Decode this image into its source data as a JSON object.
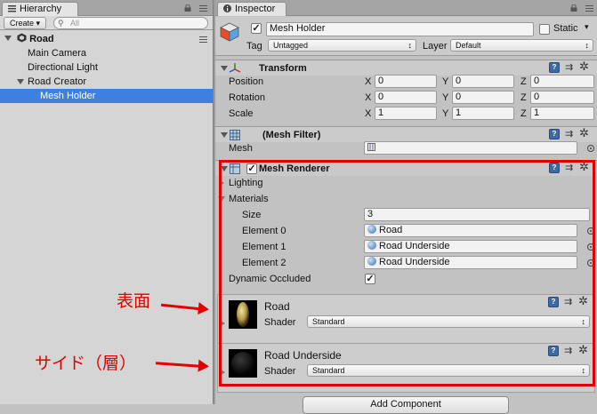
{
  "hierarchy": {
    "tab_label": "Hierarchy",
    "create_label": "Create",
    "search_placeholder": "All",
    "scene_name": "Road",
    "items": [
      {
        "label": "Main Camera"
      },
      {
        "label": "Directional Light"
      },
      {
        "label": "Road Creator"
      },
      {
        "label": "Mesh Holder"
      }
    ]
  },
  "inspector": {
    "tab_label": "Inspector",
    "object_name": "Mesh Holder",
    "static_label": "Static",
    "tag_label": "Tag",
    "tag_value": "Untagged",
    "layer_label": "Layer",
    "layer_value": "Default",
    "transform": {
      "title": "Transform",
      "position_label": "Position",
      "rotation_label": "Rotation",
      "scale_label": "Scale",
      "axis_x": "X",
      "axis_y": "Y",
      "axis_z": "Z",
      "position": [
        "0",
        "0",
        "0"
      ],
      "rotation": [
        "0",
        "0",
        "0"
      ],
      "scale": [
        "1",
        "1",
        "1"
      ]
    },
    "mesh_filter": {
      "title": "(Mesh Filter)",
      "mesh_label": "Mesh"
    },
    "mesh_renderer": {
      "title": "Mesh Renderer",
      "lighting_label": "Lighting",
      "materials_label": "Materials",
      "size_label": "Size",
      "size_value": "3",
      "elements": [
        {
          "label": "Element 0",
          "value": "Road"
        },
        {
          "label": "Element 1",
          "value": "Road Underside"
        },
        {
          "label": "Element 2",
          "value": "Road Underside"
        }
      ],
      "dynamic_occluded_label": "Dynamic Occluded"
    },
    "materials": [
      {
        "name": "Road",
        "shader_label": "Shader",
        "shader_value": "Standard"
      },
      {
        "name": "Road Underside",
        "shader_label": "Shader",
        "shader_value": "Standard"
      }
    ],
    "add_component_label": "Add Component"
  },
  "annotations": {
    "surface": "表面",
    "side": "サイド（層）"
  },
  "colors": {
    "selection": "#3d80df",
    "highlight": "#e20000"
  }
}
